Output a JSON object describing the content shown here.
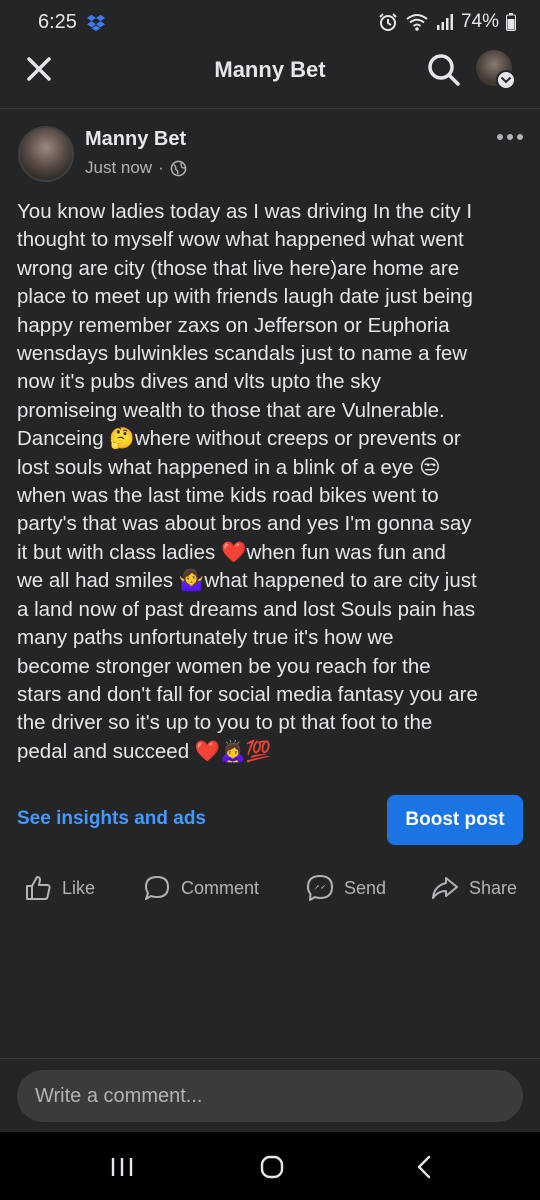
{
  "status": {
    "time": "6:25",
    "battery": "74%",
    "icons": [
      "dropbox-icon",
      "alarm-icon",
      "wifi-icon",
      "signal-icon",
      "battery-icon"
    ]
  },
  "header": {
    "title": "Manny Bet",
    "icons": [
      "close-icon",
      "search-icon",
      "profile-avatar",
      "chevron-down-icon"
    ]
  },
  "post": {
    "author": "Manny Bet",
    "timestamp": "Just now",
    "privacy_separator": "·",
    "privacy_icon": "globe-icon",
    "lines": [
      "You know ladies today as I was driving In the city I",
      "thought to myself wow what happened  what went",
      "wrong  are city (those that live here)are home are",
      "place to meet up with friends laugh date just being",
      "happy remember zaxs on Jefferson  or Euphoria",
      "wensdays  bulwinkles scandals just to name a few",
      "now it's pubs dives and vlts upto the sky",
      "promiseing wealth to those that are Vulnerable.",
      "Danceing 🤔where without creeps or prevents  or",
      "lost souls what happened in a blink of a eye 😒",
      "when was the last time kids road bikes went to",
      "party's that was about bros and yes I'm gonna say",
      "it but with class ladies ❤️when fun was fun and",
      "we all had smiles 🤷‍♀️what happened to are city just",
      "a land now of past dreams and lost Souls  pain has",
      "many paths unfortunately true  it's how we",
      "become stronger women be you reach for the",
      "stars and don't fall for social media fantasy you are",
      "the driver so it's up to you to pt that foot to the",
      "pedal and succeed ❤️🙇‍♀️💯"
    ]
  },
  "promo": {
    "insights_label": "See insights and ads",
    "boost_label": "Boost post"
  },
  "actions": {
    "like": "Like",
    "comment": "Comment",
    "send": "Send",
    "share": "Share"
  },
  "comment": {
    "placeholder": "Write a comment..."
  },
  "nav": {
    "icons": [
      "recents-icon",
      "home-icon",
      "back-icon"
    ]
  },
  "colors": {
    "background": "#242526",
    "text": "#e4e6eb",
    "secondary_text": "#b0b3b8",
    "link_blue": "#4599ff",
    "button_blue": "#1b74e4",
    "input_bg": "#3a3b3c"
  }
}
